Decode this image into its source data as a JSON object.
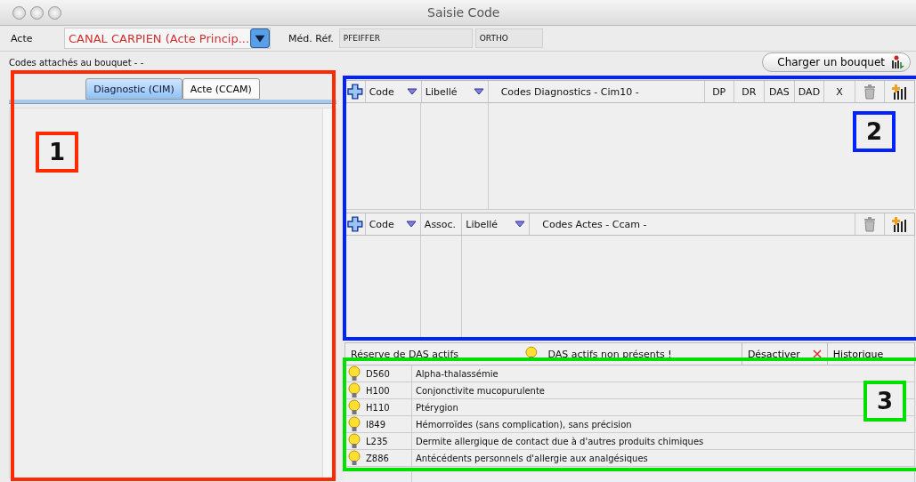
{
  "window": {
    "title": "Saisie Code"
  },
  "header": {
    "acte_label": "Acte",
    "acte_value": "CANAL CARPIEN (Acte Princip...",
    "med_ref_label": "Méd. Réf.",
    "med_ref_name": "PFEIFFER",
    "med_ref_specialty": "ORTHO"
  },
  "bouquet": {
    "label": "Codes attachés au bouquet -  -",
    "load_button": "Charger un bouquet"
  },
  "tabs": [
    {
      "label": "Diagnostic (CIM)",
      "selected": true
    },
    {
      "label": "Acte (CCAM)",
      "selected": false
    }
  ],
  "diagnostics_table": {
    "columns": [
      {
        "label": "Code",
        "sortable": true
      },
      {
        "label": "Libellé",
        "sortable": true
      },
      {
        "label": "Codes Diagnostics - Cim10 -",
        "sortable": false
      },
      {
        "label": "DP",
        "sortable": false
      },
      {
        "label": "DR",
        "sortable": false
      },
      {
        "label": "DAS",
        "sortable": false
      },
      {
        "label": "DAD",
        "sortable": false
      },
      {
        "label": "X",
        "sortable": false
      }
    ]
  },
  "acts_table": {
    "columns": [
      {
        "label": "Code",
        "sortable": true
      },
      {
        "label": "Assoc.",
        "sortable": false
      },
      {
        "label": "Libellé",
        "sortable": true
      },
      {
        "label": "Codes Actes - Ccam -",
        "sortable": false
      }
    ]
  },
  "das_reserve": {
    "title": "Réserve de DAS actifs",
    "warning": "DAS actifs non présents !",
    "deactivate_button": "Désactiver",
    "history_button": "Historique",
    "rows": [
      {
        "code": "D560",
        "label": "Alpha-thalassémie"
      },
      {
        "code": "H100",
        "label": "Conjonctivite mucopurulente"
      },
      {
        "code": "H110",
        "label": "Ptérygion"
      },
      {
        "code": "I849",
        "label": "Hémorroïdes (sans complication), sans précision"
      },
      {
        "code": "L235",
        "label": "Dermite allergique de contact due à d'autres produits chimiques"
      },
      {
        "code": "Z886",
        "label": "Antécédents personnels d'allergie aux analgésiques"
      }
    ]
  },
  "annotations": [
    {
      "number": "1",
      "color": "#ff2a00"
    },
    {
      "number": "2",
      "color": "#0022ff"
    },
    {
      "number": "3",
      "color": "#00e000"
    }
  ]
}
